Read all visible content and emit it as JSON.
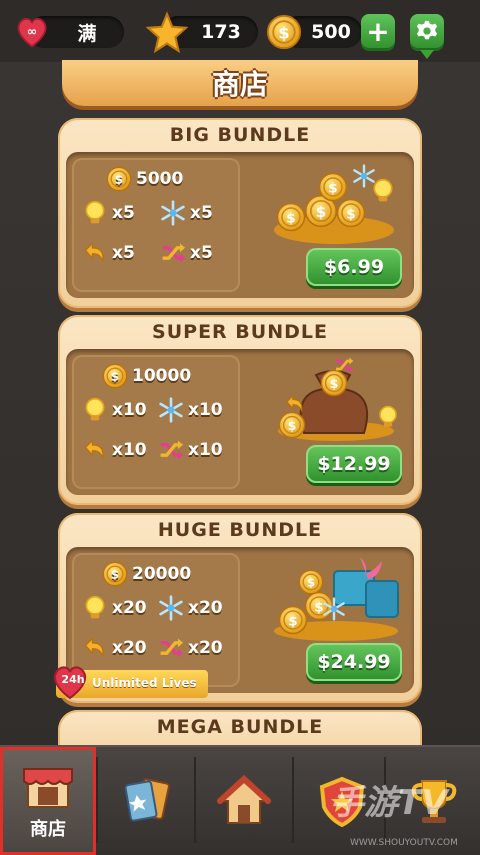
{
  "topbar": {
    "lives_value": "满",
    "stars_value": "173",
    "coins_value": "500",
    "add_label": "+",
    "colors": {
      "bar": "#2e2b29",
      "heart": "#e0354b",
      "star": "#f7b52c",
      "coin": "#f4b82a",
      "green": "#3aa336"
    }
  },
  "page_title": "商店",
  "bundles": [
    {
      "title": "BIG BUNDLE",
      "coins": "5000",
      "bulb": "x5",
      "snow": "x5",
      "undo": "x5",
      "shuffle": "x5",
      "price": "$6.99"
    },
    {
      "title": "SUPER BUNDLE",
      "coins": "10000",
      "bulb": "x10",
      "snow": "x10",
      "undo": "x10",
      "shuffle": "x10",
      "price": "$12.99"
    },
    {
      "title": "HUGE BUNDLE",
      "coins": "20000",
      "bulb": "x20",
      "snow": "x20",
      "undo": "x20",
      "shuffle": "x20",
      "price": "$24.99",
      "badge_hours": "24h",
      "badge_label": "Unlimited Lives"
    },
    {
      "title": "MEGA BUNDLE"
    }
  ],
  "navbar": {
    "tabs": [
      {
        "label": "商店",
        "icon": "shop-icon",
        "selected": true
      },
      {
        "label": "",
        "icon": "cards-icon"
      },
      {
        "label": "",
        "icon": "home-icon"
      },
      {
        "label": "",
        "icon": "shield-icon"
      },
      {
        "label": "",
        "icon": "trophy-icon"
      }
    ]
  },
  "watermark": {
    "text": "手游TV",
    "url": "WWW.SHOUYOUTV.COM"
  }
}
